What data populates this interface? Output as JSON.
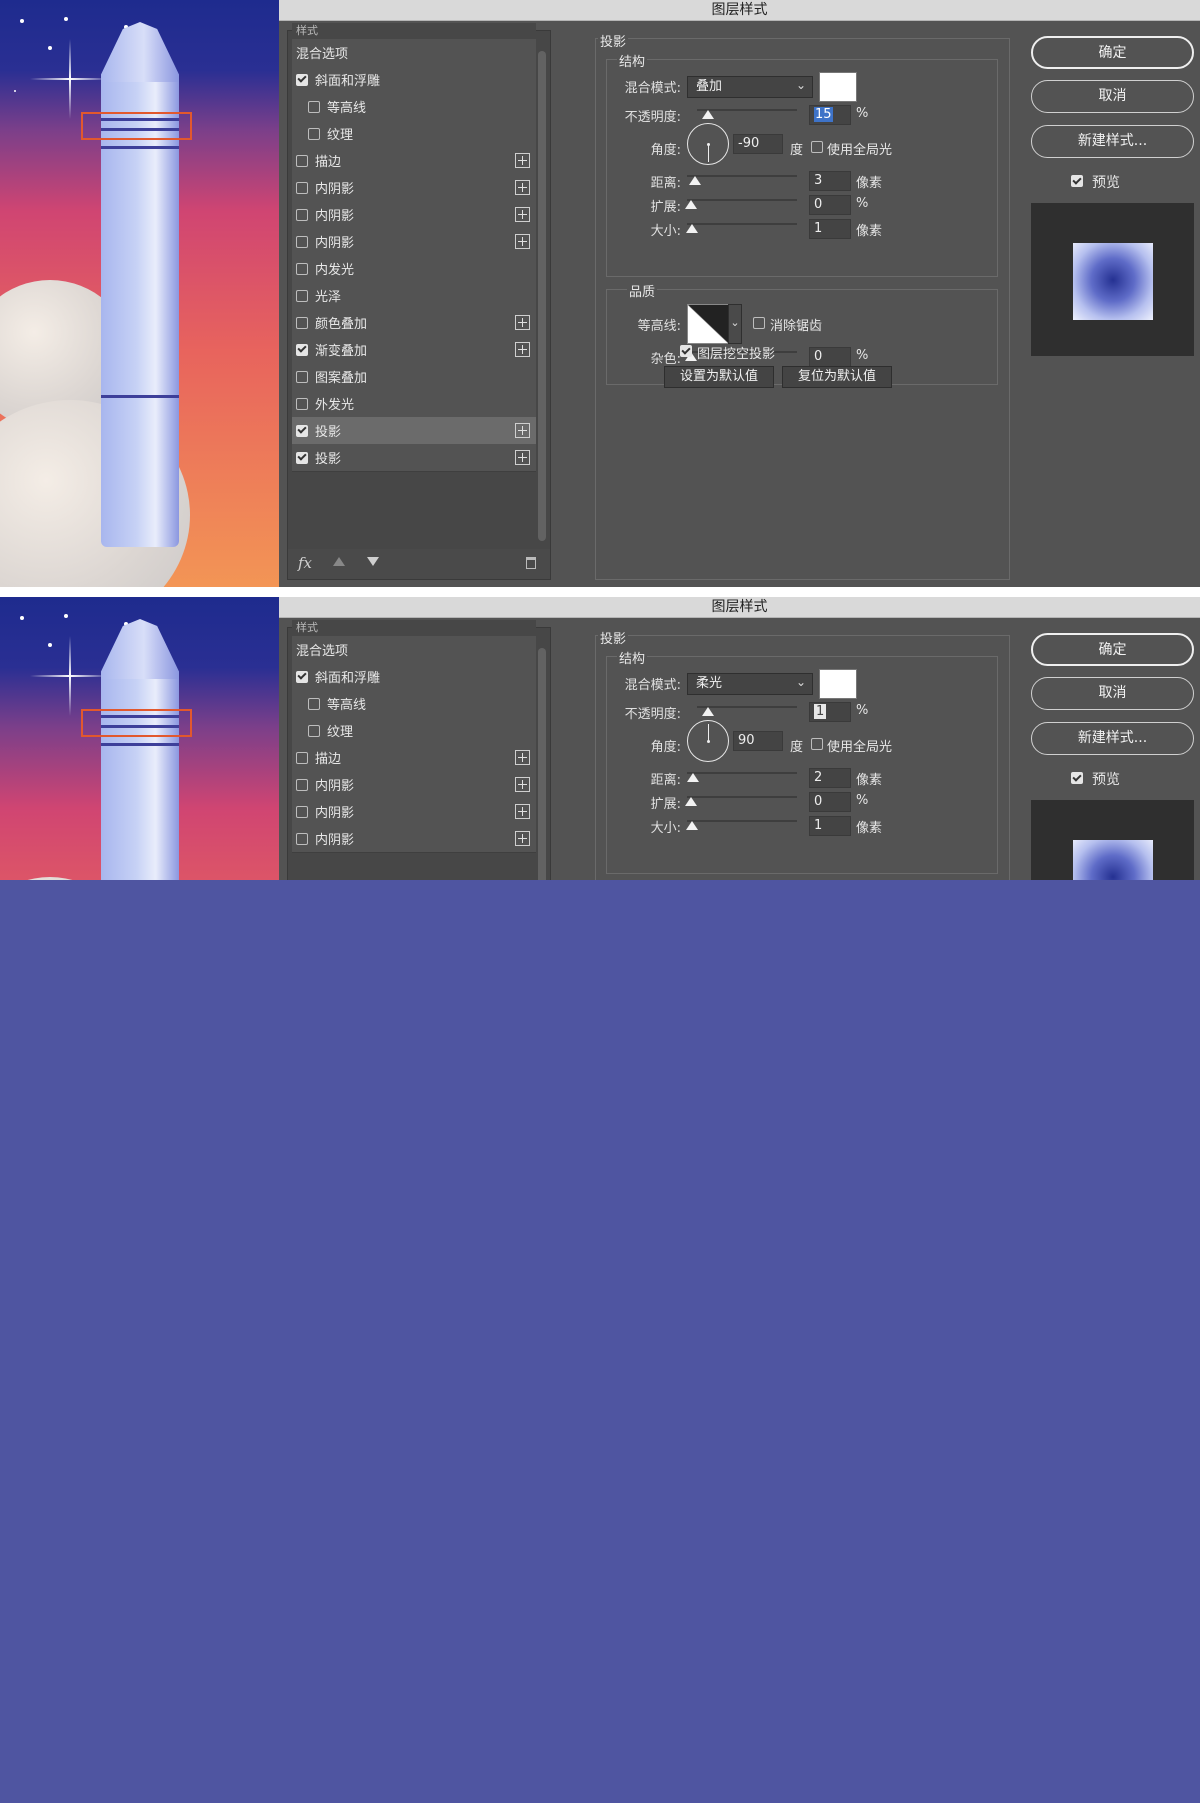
{
  "dialog_title": "图层样式",
  "screen1": {
    "styles_header": "样式",
    "styles": [
      {
        "label": "混合选项",
        "checkbox": false,
        "checked": false,
        "indent": false,
        "plus": false,
        "selected": false
      },
      {
        "label": "斜面和浮雕",
        "checkbox": true,
        "checked": true,
        "indent": false,
        "plus": false,
        "selected": false
      },
      {
        "label": "等高线",
        "checkbox": true,
        "checked": false,
        "indent": true,
        "plus": false,
        "selected": false
      },
      {
        "label": "纹理",
        "checkbox": true,
        "checked": false,
        "indent": true,
        "plus": false,
        "selected": false
      },
      {
        "label": "描边",
        "checkbox": true,
        "checked": false,
        "indent": false,
        "plus": true,
        "selected": false
      },
      {
        "label": "内阴影",
        "checkbox": true,
        "checked": false,
        "indent": false,
        "plus": true,
        "selected": false
      },
      {
        "label": "内阴影",
        "checkbox": true,
        "checked": false,
        "indent": false,
        "plus": true,
        "selected": false
      },
      {
        "label": "内阴影",
        "checkbox": true,
        "checked": false,
        "indent": false,
        "plus": true,
        "selected": false
      },
      {
        "label": "内发光",
        "checkbox": true,
        "checked": false,
        "indent": false,
        "plus": false,
        "selected": false
      },
      {
        "label": "光泽",
        "checkbox": true,
        "checked": false,
        "indent": false,
        "plus": false,
        "selected": false
      },
      {
        "label": "颜色叠加",
        "checkbox": true,
        "checked": false,
        "indent": false,
        "plus": true,
        "selected": false
      },
      {
        "label": "渐变叠加",
        "checkbox": true,
        "checked": true,
        "indent": false,
        "plus": true,
        "selected": false
      },
      {
        "label": "图案叠加",
        "checkbox": true,
        "checked": false,
        "indent": false,
        "plus": false,
        "selected": false
      },
      {
        "label": "外发光",
        "checkbox": true,
        "checked": false,
        "indent": false,
        "plus": false,
        "selected": false
      },
      {
        "label": "投影",
        "checkbox": true,
        "checked": true,
        "indent": false,
        "plus": true,
        "selected": true
      },
      {
        "label": "投影",
        "checkbox": true,
        "checked": true,
        "indent": false,
        "plus": true,
        "selected": false
      }
    ],
    "footer": {
      "fx": "fx"
    },
    "settings": {
      "section_title": "投影",
      "structure_title": "结构",
      "blend_mode_label": "混合模式:",
      "blend_mode_value": "叠加",
      "opacity_label": "不透明度:",
      "opacity_value": "15",
      "opacity_unit": "%",
      "angle_label": "角度:",
      "angle_value": "-90",
      "angle_unit": "度",
      "global_light_label": "使用全局光",
      "global_light_checked": false,
      "distance_label": "距离:",
      "distance_value": "3",
      "distance_unit": "像素",
      "spread_label": "扩展:",
      "spread_value": "0",
      "spread_unit": "%",
      "size_label": "大小:",
      "size_value": "1",
      "size_unit": "像素",
      "quality_title": "品质",
      "contour_label": "等高线:",
      "anti_alias_label": "消除锯齿",
      "anti_alias_checked": false,
      "noise_label": "杂色:",
      "noise_value": "0",
      "noise_unit": "%",
      "knockout_label": "图层挖空投影",
      "knockout_checked": true,
      "make_default_label": "设置为默认值",
      "reset_default_label": "复位为默认值"
    },
    "buttons": {
      "ok": "确定",
      "cancel": "取消",
      "new_style": "新建样式...",
      "preview_label": "预览",
      "preview_checked": true
    }
  },
  "screen2": {
    "styles_header": "样式",
    "styles": [
      {
        "label": "混合选项",
        "checkbox": false,
        "checked": false,
        "indent": false,
        "plus": false
      },
      {
        "label": "斜面和浮雕",
        "checkbox": true,
        "checked": true,
        "indent": false,
        "plus": false
      },
      {
        "label": "等高线",
        "checkbox": true,
        "checked": false,
        "indent": true,
        "plus": false
      },
      {
        "label": "纹理",
        "checkbox": true,
        "checked": false,
        "indent": true,
        "plus": false
      },
      {
        "label": "描边",
        "checkbox": true,
        "checked": false,
        "indent": false,
        "plus": true
      },
      {
        "label": "内阴影",
        "checkbox": true,
        "checked": false,
        "indent": false,
        "plus": true
      },
      {
        "label": "内阴影",
        "checkbox": true,
        "checked": false,
        "indent": false,
        "plus": true
      },
      {
        "label": "内阴影",
        "checkbox": true,
        "checked": false,
        "indent": false,
        "plus": true
      }
    ],
    "settings": {
      "section_title": "投影",
      "structure_title": "结构",
      "blend_mode_label": "混合模式:",
      "blend_mode_value": "柔光",
      "opacity_label": "不透明度:",
      "opacity_value": "1",
      "opacity_unit": "%",
      "angle_label": "角度:",
      "angle_value": "90",
      "angle_unit": "度",
      "global_light_label": "使用全局光",
      "global_light_checked": false,
      "distance_label": "距离:",
      "distance_value": "2",
      "distance_unit": "像素",
      "spread_label": "扩展:",
      "spread_value": "0",
      "spread_unit": "%",
      "size_label": "大小:",
      "size_value": "1",
      "size_unit": "像素"
    },
    "buttons": {
      "ok": "确定",
      "cancel": "取消",
      "new_style": "新建样式...",
      "preview_label": "预览",
      "preview_checked": true
    }
  },
  "colors": {
    "background_fill": "#4f55a1",
    "dialog_bg": "#535353",
    "selection_box": "#e2582d",
    "highlight_blue": "#3e73c8"
  }
}
